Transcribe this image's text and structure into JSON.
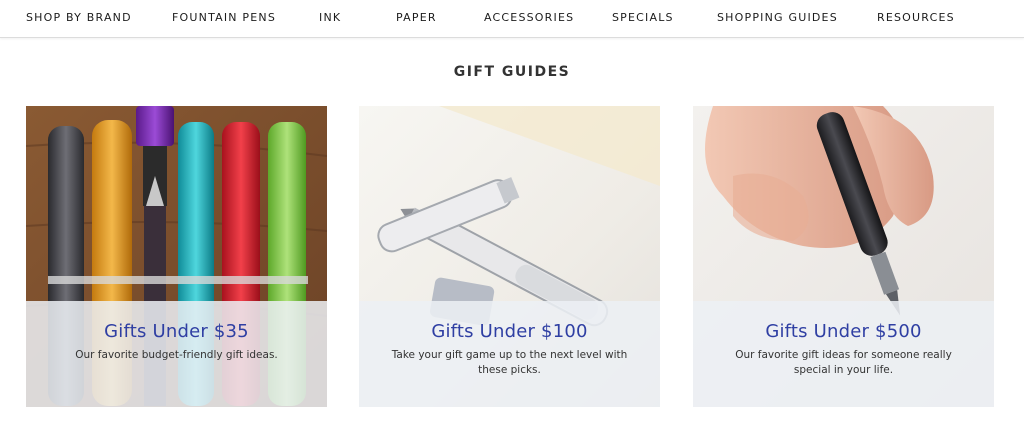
{
  "nav": {
    "items": [
      {
        "label": "SHOP BY BRAND"
      },
      {
        "label": "FOUNTAIN PENS"
      },
      {
        "label": "INK"
      },
      {
        "label": "PAPER"
      },
      {
        "label": "ACCESSORIES"
      },
      {
        "label": "SPECIALS"
      },
      {
        "label": "SHOPPING GUIDES"
      },
      {
        "label": "RESOURCES"
      }
    ]
  },
  "section": {
    "title": "GIFT GUIDES"
  },
  "cards": [
    {
      "title": "Gifts Under $35",
      "desc": "Our favorite budget-friendly gift ideas."
    },
    {
      "title": "Gifts Under $100",
      "desc": "Take your gift game up to the next level with these picks."
    },
    {
      "title": "Gifts Under $500",
      "desc": "Our favorite gift ideas for someone really special in your life."
    }
  ],
  "colors": {
    "accent": "#2f3fa3",
    "overlay": "#eceff5"
  }
}
